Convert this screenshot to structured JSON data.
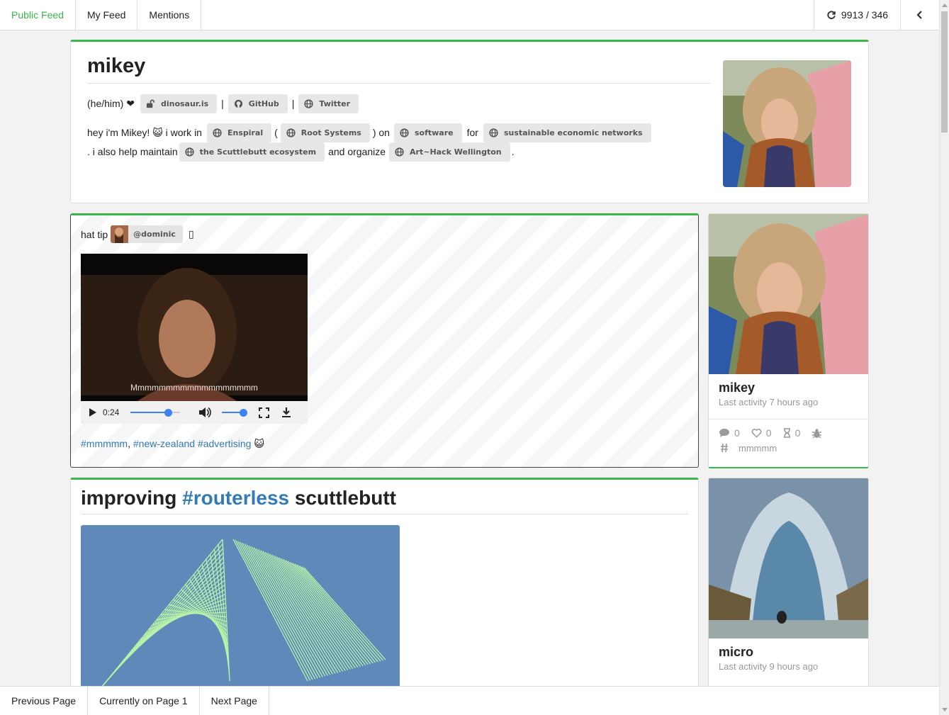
{
  "nav": {
    "tabs": [
      {
        "label": "Public Feed",
        "active": true
      },
      {
        "label": "My Feed"
      },
      {
        "label": "Mentions"
      }
    ],
    "sync_count": "9913 / 346",
    "icons": {
      "sync": "refresh-icon",
      "collapse": "chevron-left-icon"
    }
  },
  "profile": {
    "name": "mikey",
    "pronouns": "(he/him) ❤",
    "links": [
      {
        "label": "dinosaur.is",
        "icon": "unlock-icon"
      },
      {
        "label": "GitHub",
        "icon": "github-icon"
      },
      {
        "label": "Twitter",
        "icon": "globe-icon"
      }
    ],
    "separator": "|",
    "bio": {
      "t1": "hey i'm Mikey! 😺 i work in",
      "p1": "Enspiral",
      "t2": "(",
      "p2": "Root Systems",
      "t3": ") on",
      "p3": "software",
      "t4": "for",
      "p4": "sustainable economic networks",
      "t5": ". i also help maintain",
      "p5": "the Scuttlebutt ecosystem",
      "t6": "and organize",
      "p6": "Art~Hack Wellington",
      "t7": "."
    }
  },
  "post1": {
    "prefix": "hat tip",
    "mention": "@dominic",
    "trailing": "▯",
    "video": {
      "caption": "Mmmmmmmmmmmmmmmmmm",
      "time": "0:24",
      "progress": 0.76,
      "volume": 1.0
    },
    "tags": [
      "#mmmmm",
      "#new-zealand",
      "#advertising"
    ],
    "tag_sep": ",",
    "emoji": "😺"
  },
  "post2": {
    "title_before": "improving",
    "title_tag": "#routerless",
    "title_after": "scuttlebutt"
  },
  "sidebar": {
    "cards": [
      {
        "name": "mikey",
        "activity": "Last activity 7 hours ago",
        "stats": {
          "comments": "0",
          "likes": "0",
          "hourglass": "0"
        },
        "tag": "mmmmm"
      },
      {
        "name": "micro",
        "activity": "Last activity 9 hours ago"
      }
    ]
  },
  "pager": {
    "prev": "Previous Page",
    "current": "Currently on Page 1",
    "next": "Next Page"
  },
  "colors": {
    "accent": "#3ab64a",
    "link": "#337ab7",
    "video_progress": "#3b82f6"
  }
}
